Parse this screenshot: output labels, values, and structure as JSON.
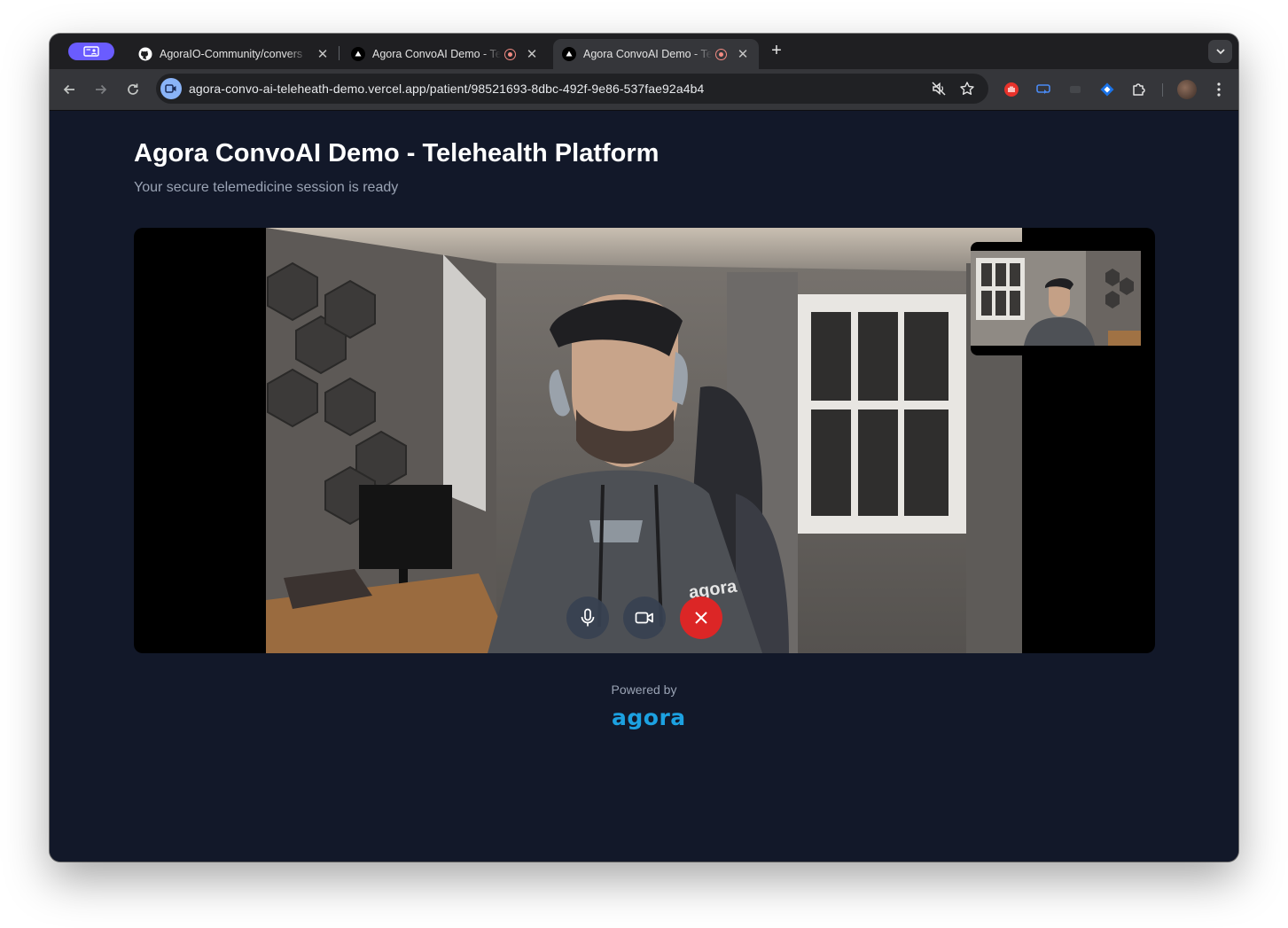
{
  "tabs": [
    {
      "title": "AgoraIO-Community/convers",
      "favicon": "github-icon",
      "active": false
    },
    {
      "title": "Agora ConvoAI Demo - Te",
      "favicon": "vercel-icon",
      "recording": true,
      "active": false
    },
    {
      "title": "Agora ConvoAI Demo - Te",
      "favicon": "vercel-icon",
      "recording": true,
      "active": true
    }
  ],
  "toolbar": {
    "url": "agora-convo-ai-teleheath-demo.vercel.app/patient/98521693-8dbc-492f-9e86-537fae92a4b4"
  },
  "page": {
    "title": "Agora ConvoAI Demo - Telehealth Platform",
    "subtitle": "Your secure telemedicine session is ready",
    "powered_by": "Powered by",
    "logo_text": "agora"
  },
  "video": {
    "hoodie_text": "agora"
  },
  "controls": {
    "mic": "microphone-icon",
    "camera": "video-camera-icon",
    "end_call": "close-icon"
  },
  "colors": {
    "page_bg": "#121829",
    "accent": "#1ca1e1",
    "end_call": "#dc2626",
    "profile_pill": "#6a5cff"
  }
}
